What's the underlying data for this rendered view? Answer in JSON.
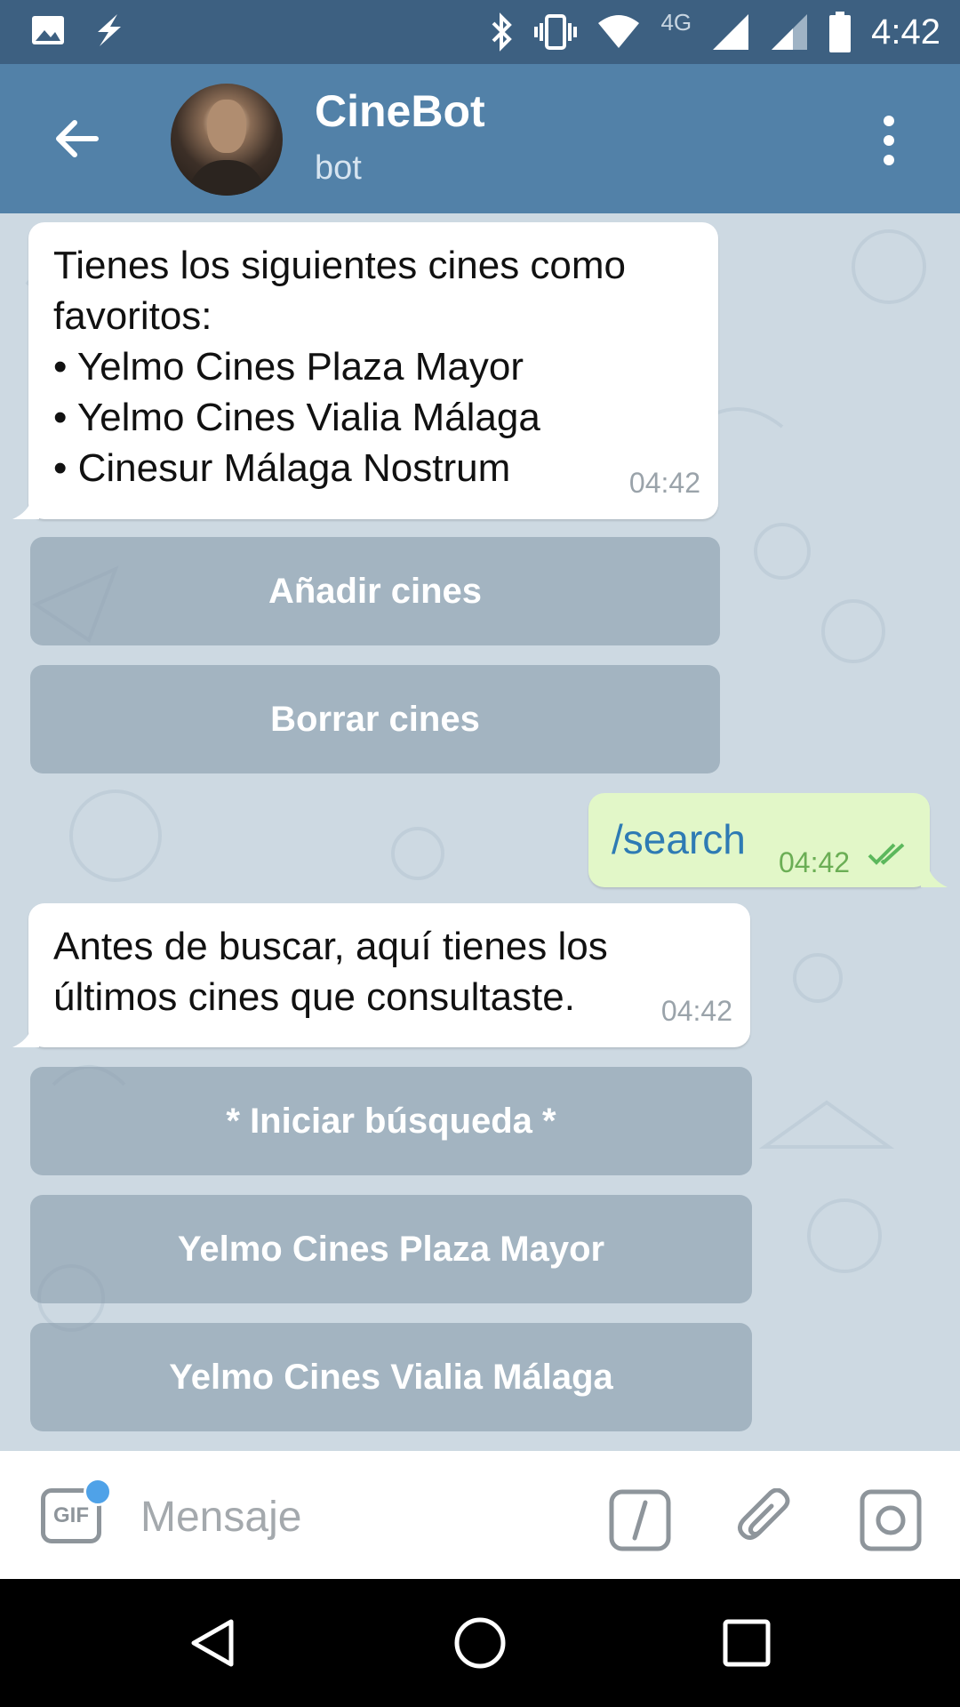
{
  "status_bar": {
    "time": "4:42",
    "network": "4G"
  },
  "header": {
    "title": "CineBot",
    "subtitle": "bot"
  },
  "messages": [
    {
      "lines": [
        "Tienes los siguientes cines como",
        "favoritos:",
        "• Yelmo Cines Plaza Mayor",
        "• Yelmo Cines Vialia Málaga",
        "• Cinesur Málaga  Nostrum"
      ],
      "time": "04:42"
    },
    {
      "text": "/search",
      "time": "04:42"
    },
    {
      "lines": [
        "Antes de buscar, aquí tienes los",
        "últimos cines que consultaste."
      ],
      "time": "04:42"
    }
  ],
  "keyboard1": [
    "Añadir cines",
    "Borrar cines"
  ],
  "keyboard2": [
    "* Iniciar búsqueda *",
    "Yelmo Cines Plaza Mayor",
    "Yelmo Cines Vialia Málaga"
  ],
  "input": {
    "placeholder": "Mensaje"
  },
  "icons": {
    "status_left": [
      "image-icon",
      "flash-icon"
    ],
    "status_right": [
      "bluetooth-icon",
      "vibrate-icon",
      "wifi-icon",
      "signal-icon",
      "signal-icon",
      "battery-icon"
    ],
    "header": [
      "back-arrow-icon",
      "more-vert-icon"
    ],
    "input": [
      "gif-icon",
      "slash-command-icon",
      "attach-icon",
      "camera-icon"
    ],
    "nav": [
      "back-icon",
      "home-icon",
      "recents-icon"
    ]
  },
  "colors": {
    "header": "#5281a8",
    "status_bar": "#3d6081",
    "outgoing_bubble": "#e2f7c8",
    "check": "#5cb85c"
  }
}
